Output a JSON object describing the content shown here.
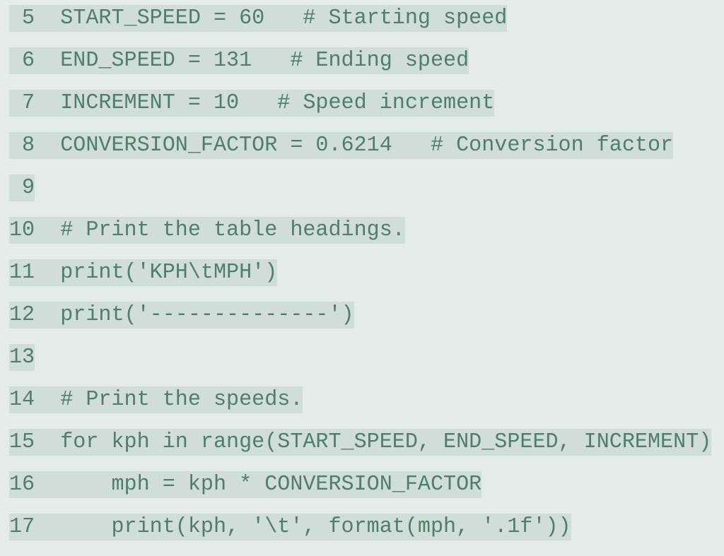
{
  "code_listing": {
    "lines": [
      {
        "number": " 5",
        "text": "START_SPEED = 60   # Starting speed"
      },
      {
        "number": " 6",
        "text": "END_SPEED = 131   # Ending speed"
      },
      {
        "number": " 7",
        "text": "INCREMENT = 10   # Speed increment"
      },
      {
        "number": " 8",
        "text": "CONVERSION_FACTOR = 0.6214   # Conversion factor"
      },
      {
        "number": " 9",
        "text": ""
      },
      {
        "number": "10",
        "text": "# Print the table headings."
      },
      {
        "number": "11",
        "text": "print('KPH\\tMPH')"
      },
      {
        "number": "12",
        "text": "print('--------------')"
      },
      {
        "number": "13",
        "text": ""
      },
      {
        "number": "14",
        "text": "# Print the speeds."
      },
      {
        "number": "15",
        "text": "for kph in range(START_SPEED, END_SPEED, INCREMENT)"
      },
      {
        "number": "16",
        "text": "    mph = kph * CONVERSION_FACTOR"
      },
      {
        "number": "17",
        "text": "    print(kph, '\\t', format(mph, '.1f'))"
      }
    ]
  },
  "colors": {
    "background": "#e4ebe8",
    "line_highlight": "#d0ddd8",
    "text": "#4e7f6c"
  }
}
